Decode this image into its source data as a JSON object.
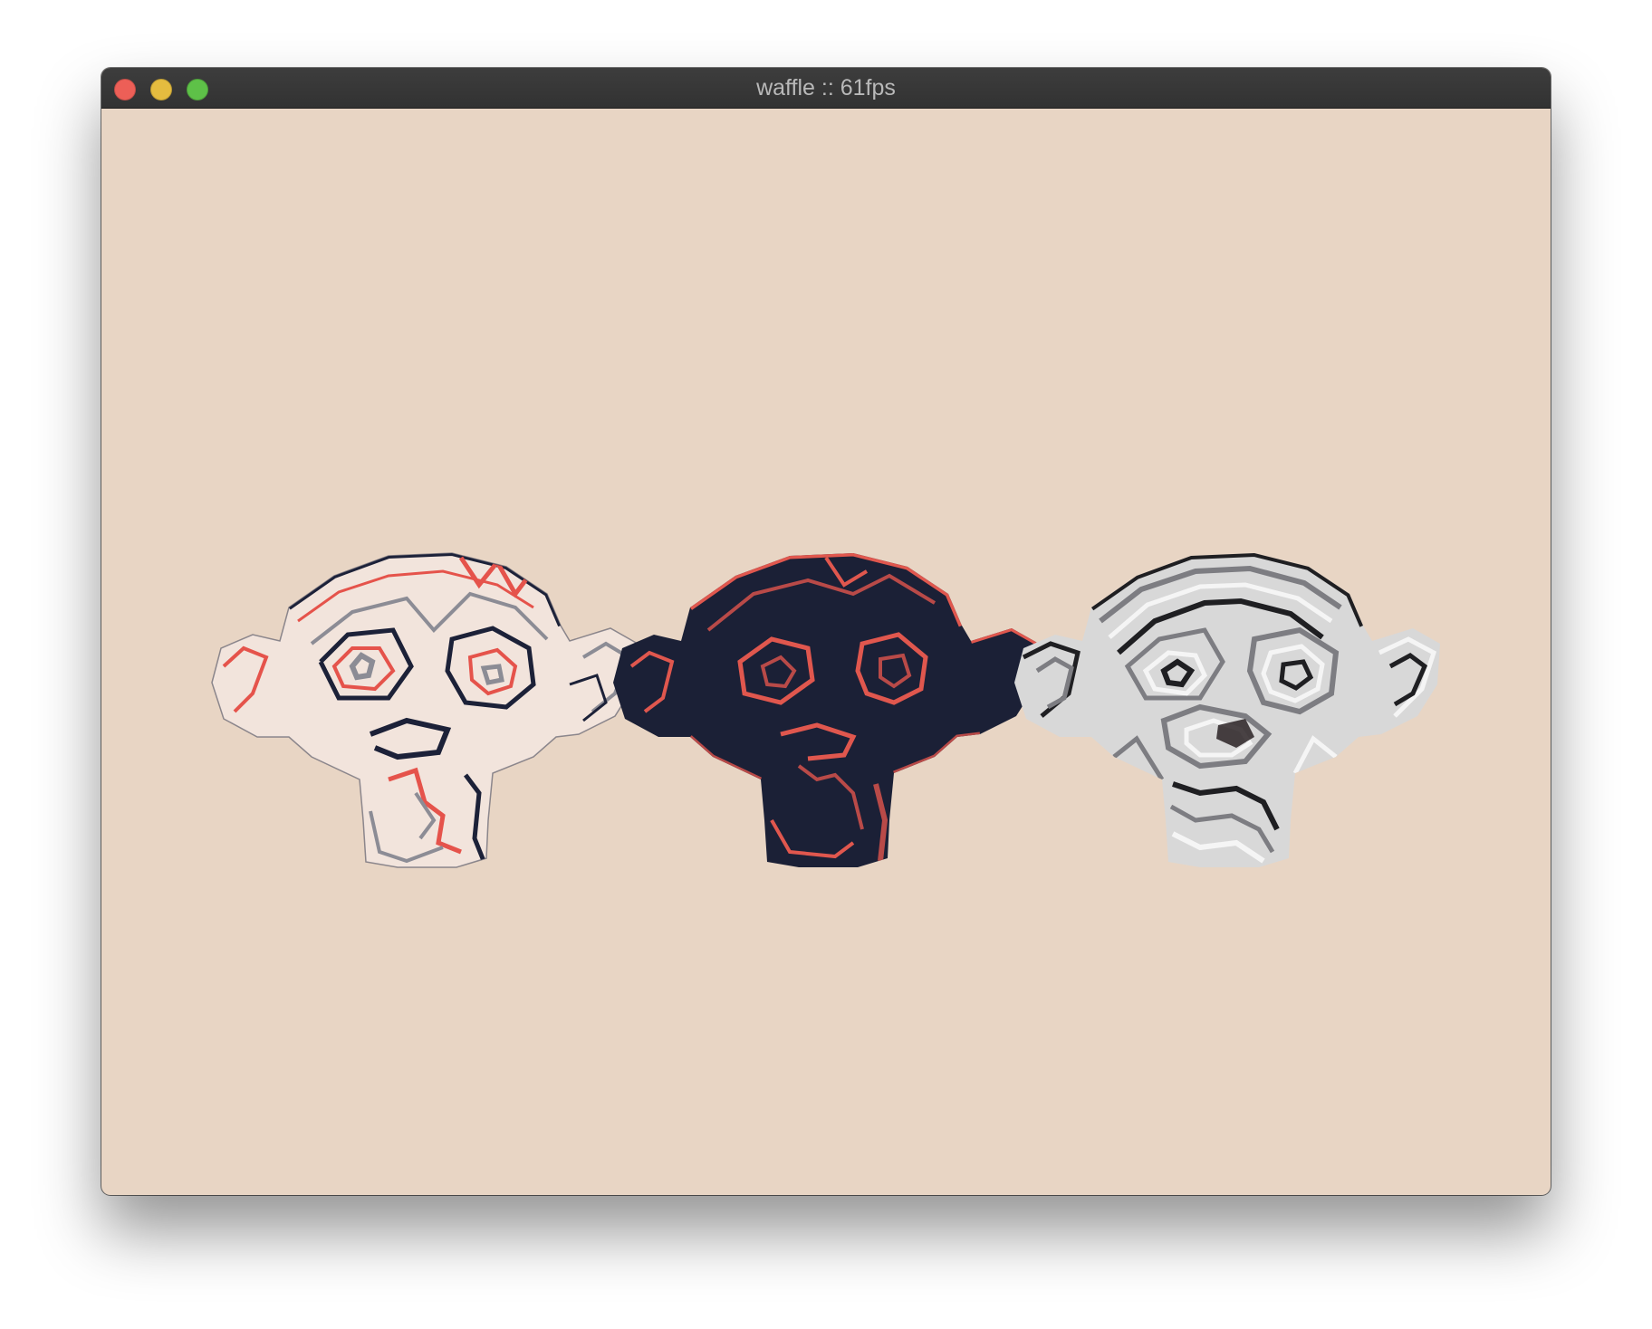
{
  "window": {
    "title": "waffle :: 61fps",
    "background_color": "#e8d5c4",
    "titlebar_color": "#383838",
    "traffic_lights": [
      {
        "name": "close",
        "color": "#ed5f57"
      },
      {
        "name": "minimize",
        "color": "#e5bc3f"
      },
      {
        "name": "zoom",
        "color": "#5ec148"
      }
    ]
  },
  "scene": {
    "models": [
      {
        "name": "monkey-light",
        "base_color": "#f2e4dc",
        "line_colors": [
          "#1c2138",
          "#e5534b",
          "#8c8c95"
        ]
      },
      {
        "name": "monkey-dark",
        "base_color": "#1b2036",
        "line_colors": [
          "#e0574e",
          "#b94a48"
        ]
      },
      {
        "name": "monkey-gray",
        "base_color": "#d8d8d8",
        "line_colors": [
          "#1f1f22",
          "#7d7d82",
          "#f5f5f5"
        ]
      }
    ]
  }
}
